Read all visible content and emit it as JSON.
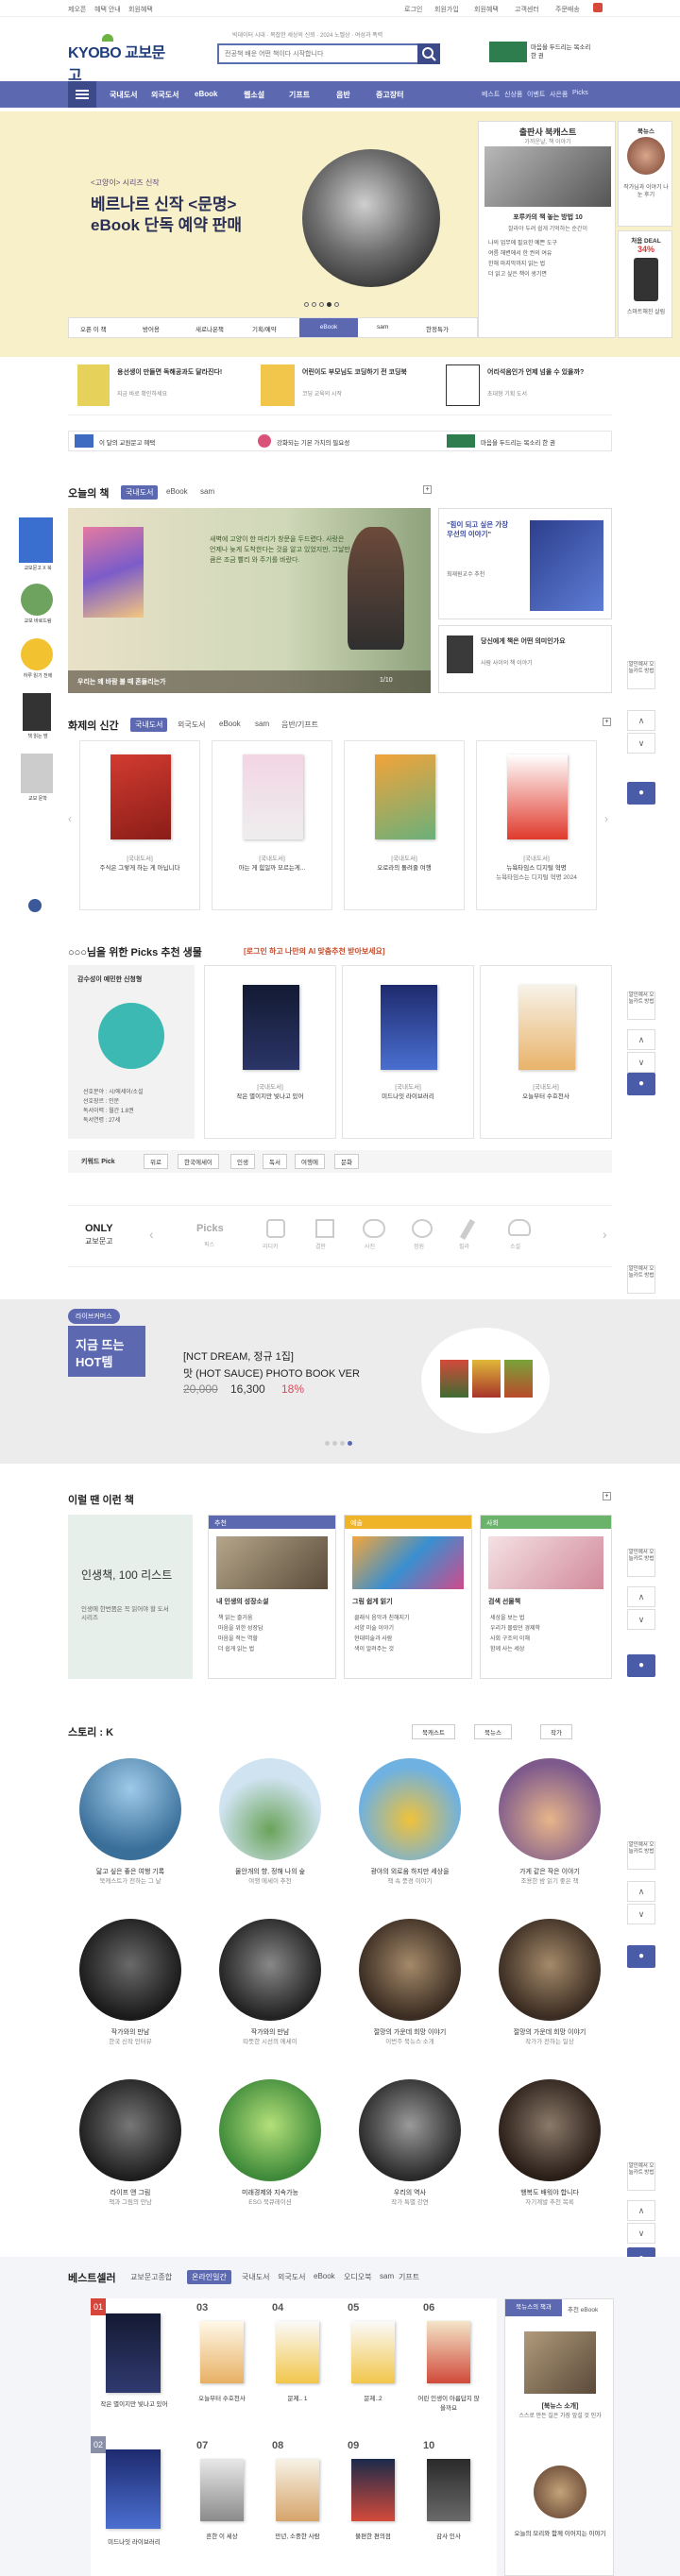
{
  "util": {
    "left1": "제오픈",
    "left2": "혜택 안내",
    "left3": "회원혜택",
    "right": [
      "로그인",
      "회원가입",
      "회원혜택",
      "고객센터",
      "주문배송"
    ]
  },
  "header": {
    "logo": "KYOBO 교보문고",
    "logo_sub": "",
    "search_hint": "전공책 배운 어떤 책이다 시작합니다",
    "tags": [
      "빅데이터 시대",
      "복잡한 세상의 신뢰",
      "2024 노벨상",
      "여성과 폭력"
    ],
    "partner": "마음을 두드리는 목소리 한 권"
  },
  "nav": {
    "items": [
      "국내도서",
      "외국도서",
      "eBook",
      "웹소설",
      "기프트",
      "음반",
      "중고장터"
    ],
    "right": [
      "베스트",
      "신상품",
      "이벤트",
      "사은품",
      "Picks"
    ]
  },
  "hero": {
    "small": "<고양이> 시리즈 신작",
    "title1": "베르나르 신작 <문명>",
    "title2": "eBook 단독 예약 판매",
    "pager": "",
    "tabs": [
      "오픈 이 책",
      "방어용",
      "새로나온책",
      "기획/예약",
      "eBook",
      "sam",
      "한정특가"
    ],
    "right_head": "출판사 북캐스트",
    "right_sub": "가까운날, 책 이야기",
    "right_title": "포루카의 책 놓는 방법 10",
    "right_text": "잘라야 두려 쉽게 기억하는 순간이",
    "right_list": [
      "나의 업무에 필요한 예쁜 도구",
      "여름 해변에서 한 권의 여유",
      "한해 마지막까지 읽는 법",
      "더 읽고 싶은 책이 생기면"
    ],
    "side_card1_title": "북뉴스",
    "side_card1_text": "작가님과 이야기 나눈 후기",
    "side_card2_title": "처음 DEAL",
    "side_card2_pct": "34%",
    "side_card2_text": "스마트해진 살림"
  },
  "promo": {
    "a_title": "용선생이 만들면 독해공과도 달라진다!",
    "a_sub": "지금 바로 확인하세요",
    "b_title": "어린이도 부모님도 코딩하기 전 코딩북",
    "b_sub": "코딩 교육의 시작",
    "c_title": "어리석음인가 언제 넘을 수 있을까?",
    "c_sub": "초대형 기획 도서",
    "strip": [
      "이 달의 교원문고 혜택",
      "강화되는 기본 가치의 필요성",
      "",
      "마음을 두드리는 목소리 한 권"
    ]
  },
  "today": {
    "title": "오늘의 책",
    "tabs": [
      "국내도서",
      "eBook",
      "sam"
    ],
    "caption": "우리는 왜 바람 불 때 흔들리는가",
    "pager": "1/10",
    "quote": "새벽에 고양이 한 마리가 창문을 두드렸다. 사랑은 언제나 늦게 도착한다는 것을 알고 있었지만, 그날만큼은 조금 빨리 와 주기를 바랐다.",
    "card1": "\"힘이 되고 싶은 가장 우선의 이야기\"",
    "card1_sub": "최재원교수 추천",
    "card2": "당신에게 책은 어떤 의미인가요",
    "card2_sub": "사람 사이의 책 이야기"
  },
  "sidebar": {
    "ad1": "교보문고 X 북",
    "ad2": "교보 바로드림",
    "ad3": "하루 읽기 전에",
    "ad4": "책 읽는 밤",
    "ad5": "교보 문학"
  },
  "new_books": {
    "title": "화제의 신간",
    "tabs": [
      "국내도서",
      "외국도서",
      "eBook",
      "sam",
      "음반/기프트"
    ],
    "items": [
      {
        "cat": "[국내도서]",
        "title": "주식은 그렇게 하는 게 아닙니다",
        "t2": ""
      },
      {
        "cat": "[국내도서]",
        "title": "아는 게 힘일까 모르는게...",
        "t2": ""
      },
      {
        "cat": "[국내도서]",
        "title": "오로라의 돌려줄 여행",
        "t2": ""
      },
      {
        "cat": "[국내도서]",
        "title": "뉴욕타임스 디지털 혁명",
        "t2": "뉴욕타임스는 디지털 혁명 2024"
      }
    ]
  },
  "picks": {
    "title": "○○○님을 위한 Picks 추천 생물",
    "hint": "[로그인 하고 나만의 AI 맞춤추천 받아보세요]",
    "card_title": "감수성이 예민한 신청형",
    "card_lines": [
      "선호분야 : 시/에세이/소설",
      "선호장르 : 인문",
      "독서이력 : 월간 1.8권",
      "독서연령 : 27세"
    ],
    "books": [
      {
        "cat": "[국내도서]",
        "title": "작은 별이지만 빛나고 있어"
      },
      {
        "cat": "[국내도서]",
        "title": "미드나잇 라이브러리"
      },
      {
        "cat": "[국내도서]",
        "title": "오늘부터 수호천사"
      }
    ],
    "keyword_label": "키워드 Pick",
    "keywords": [
      "위로",
      "한국에세이",
      "인생",
      "독서",
      "여행에",
      "문화"
    ]
  },
  "only": {
    "label1": "ONLY",
    "label2": "교보문고",
    "items": [
      "Picks",
      "북마크",
      "나만의 글",
      "키 쓰기",
      "필요 공간",
      "내 책장",
      "찰떡 친구"
    ],
    "subs": [
      "픽스",
      "리디카",
      "결판",
      "사진",
      "정원",
      "필라",
      "소설"
    ]
  },
  "banner": {
    "badge": "라이브커머스",
    "big1": "지금 뜨는",
    "big2": "HOT템",
    "title": "[NCT DREAM, 정규 1집]",
    "name": "맛 (HOT SAUCE) PHOTO BOOK VER",
    "orig": "20,000",
    "price": "16,300",
    "pct": "18%"
  },
  "month": {
    "title": "이럴 땐 이런 책",
    "left_title": "인생책, 100 리스트",
    "left_sub": "인생에 한번쯤은 꼭 읽어야 할 도서 시리즈",
    "cols": [
      {
        "head": "추천",
        "tag": "화제",
        "title": "내 인생의 성장소설",
        "lines": [
          "책 읽는 즐거움",
          "마음을 위한 성장담",
          "마음을 적는 역할",
          "더 쉽게 읽는 법"
        ]
      },
      {
        "head": "예술",
        "tag": "소설",
        "title": "그림 쉽게 읽기",
        "lines": [
          "클래식 음악과 친해지기",
          "서양 미술 이야기",
          "현대미술과 사람",
          "색이 알려주는 것"
        ]
      },
      {
        "head": "사회",
        "tag": "경제",
        "title": "검색 선물책",
        "lines": [
          "세상을 보는 법",
          "우리가 몰랐던 경제학",
          "사회 구조의 이해",
          "함께 사는 세상"
        ]
      }
    ]
  },
  "story": {
    "title": "스토리 : K",
    "tabs": [
      "북캐스트",
      "북뉴스",
      "작가"
    ],
    "items": [
      {
        "t": "닮고 싶은 좋은 여행 기록",
        "s": "북캐스트가 전하는 그 날"
      },
      {
        "t": "물안개의 향, 정해 나의 숲",
        "s": "여행 에세이 추천"
      },
      {
        "t": "광야의 외로움 하지만 세상을",
        "s": "책 속 풍경 이야기"
      },
      {
        "t": "가게 같은 작은 이야기",
        "s": "조용한 밤 읽기 좋은 책"
      },
      {
        "t": "작가와의 만남",
        "s": "한국 신작 인터뷰"
      },
      {
        "t": "작가와의 만남",
        "s": "따뜻한 시선의 에세이"
      },
      {
        "t": "절망의 가운데 희망 이야기",
        "s": "이번주 북뉴스 소개"
      },
      {
        "t": "절망의 가운데 희망 이야기",
        "s": "작가가 전하는 일상"
      },
      {
        "t": "라이프 앤 그림",
        "s": "책과 그림의 만남"
      },
      {
        "t": "미래경제와 지속가능",
        "s": "ESG 북큐레이션"
      },
      {
        "t": "우리의 역사",
        "s": "작가 특별 강연"
      },
      {
        "t": "행복도 배워야 합니다",
        "s": "자기계발 추천 목록"
      }
    ]
  },
  "best": {
    "title": "베스트셀러",
    "tabs": [
      "교보문고종합",
      "온라인일간",
      "국내도서",
      "외국도서",
      "eBook",
      "오디오북",
      "sam",
      "기프트"
    ],
    "books": [
      {
        "n": "01",
        "t": "작은 별이지만 빛나고 있어"
      },
      {
        "n": "03",
        "t": "오늘부터 수호천사"
      },
      {
        "n": "04",
        "t": "문제.. 1"
      },
      {
        "n": "05",
        "t": "문제..2"
      },
      {
        "n": "06",
        "t": "어린 인생이 아름답지 않을까요"
      },
      {
        "n": "02",
        "t": "미드나잇 라이브러리"
      },
      {
        "n": "07",
        "t": "흔한 이 세상"
      },
      {
        "n": "08",
        "t": "만년, 소중한 사람"
      },
      {
        "n": "09",
        "t": "불편한 편의점"
      },
      {
        "n": "10",
        "t": "감사 인사"
      }
    ],
    "right_head": "북뉴스의 책과",
    "right_tab": "추천 eBook",
    "right_title": "[북뉴스 소개]",
    "right_text": "스스로 만든 길은 가장 앞설 것 인가",
    "right_bottom": "오늘의 모리와 함께 이어지는 이야기"
  },
  "sidebtn": {
    "label": "알인예서 오늘카트 방법",
    "up": "∧",
    "down": "∨"
  }
}
